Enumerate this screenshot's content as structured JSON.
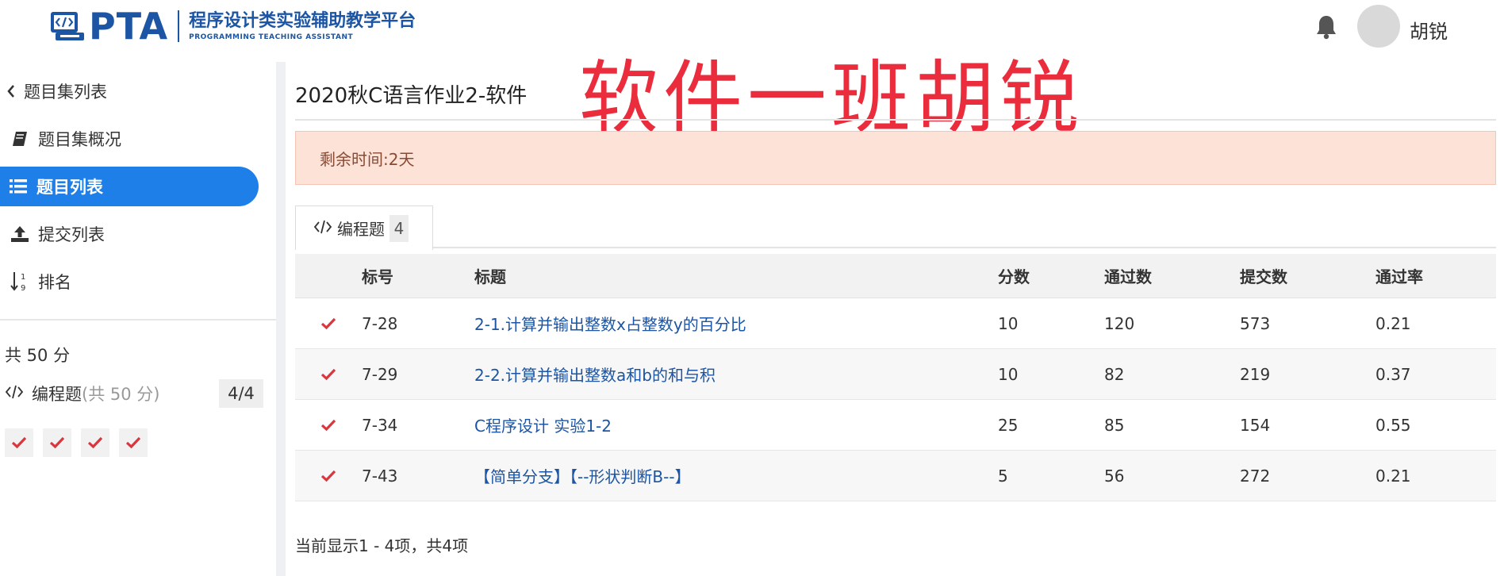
{
  "header": {
    "logo_text": "PTA",
    "logo_title_cn": "程序设计类实验辅助教学平台",
    "logo_title_en": "PROGRAMMING TEACHING ASSISTANT",
    "username": "胡锐"
  },
  "sidebar": {
    "back_label": "题目集列表",
    "items": [
      {
        "label": "题目集概况",
        "icon": "book-icon"
      },
      {
        "label": "题目列表",
        "icon": "list-icon",
        "active": true
      },
      {
        "label": "提交列表",
        "icon": "upload-icon"
      },
      {
        "label": "排名",
        "icon": "sort-numeric-icon"
      }
    ],
    "total_score": "共 50 分",
    "type_label": "编程题",
    "type_sub": "(共 50 分)",
    "type_progress": "4/4",
    "check_count": 4
  },
  "main": {
    "title": "2020秋C语言作业2-软件",
    "watermark": "软件一班胡锐",
    "remaining": "剩余时间:2天",
    "tab_label": "编程题",
    "tab_count": "4",
    "columns": [
      "标号",
      "标题",
      "分数",
      "通过数",
      "提交数",
      "通过率"
    ],
    "rows": [
      {
        "num": "7-28",
        "title": "2-1.计算并输出整数x占整数y的百分比",
        "score": "10",
        "pass": "120",
        "submit": "573",
        "rate": "0.21"
      },
      {
        "num": "7-29",
        "title": "2-2.计算并输出整数a和b的和与积",
        "score": "10",
        "pass": "82",
        "submit": "219",
        "rate": "0.37"
      },
      {
        "num": "7-34",
        "title": "C程序设计 实验1-2",
        "score": "25",
        "pass": "85",
        "submit": "154",
        "rate": "0.55"
      },
      {
        "num": "7-43",
        "title": "【简单分支】【--形状判断B--】",
        "score": "5",
        "pass": "56",
        "submit": "272",
        "rate": "0.21"
      }
    ],
    "footer": "当前显示1 - 4项，共4项"
  },
  "colors": {
    "brand": "#1c55a3",
    "active_nav": "#1f7fe8",
    "check": "#d9363e",
    "watermark": "#ea2c3c",
    "alert_bg": "#fde2d8"
  }
}
